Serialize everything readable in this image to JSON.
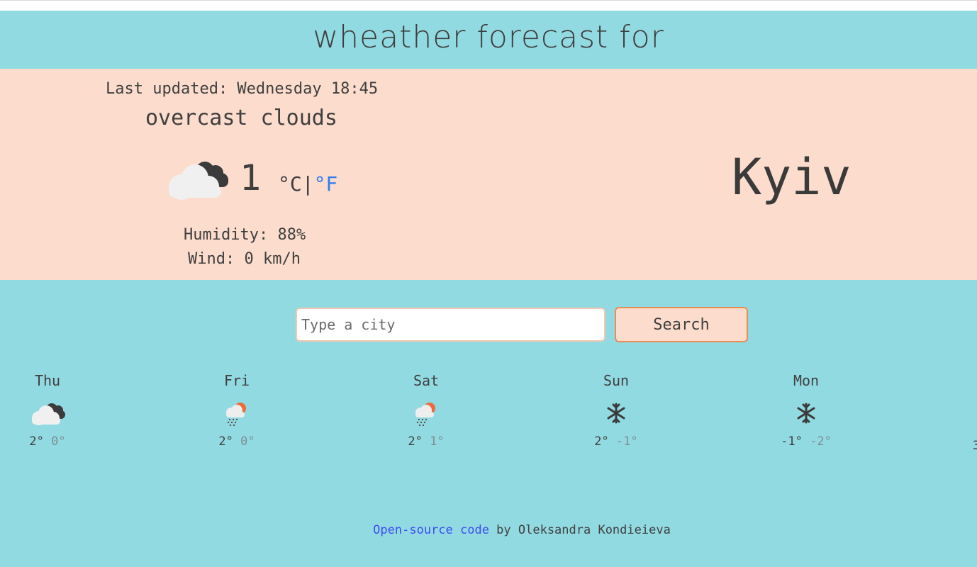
{
  "header": {
    "title": "wheather forecast for"
  },
  "current": {
    "last_updated": "Last updated: Wednesday 18:45",
    "description": "overcast clouds",
    "icon": "overcast-clouds-icon",
    "temperature": "1",
    "unit_c": "°C",
    "unit_sep": "|",
    "unit_f": "°F",
    "humidity": "Humidity: 88%",
    "wind": "Wind: 0 km/h",
    "city": "Kyiv"
  },
  "search": {
    "placeholder": "Type a city",
    "button_label": "Search"
  },
  "forecast": [
    {
      "day": "Thu",
      "icon": "overcast-clouds-icon",
      "max": "2°",
      "min": "0°"
    },
    {
      "day": "Fri",
      "icon": "sun-rain-icon",
      "max": "2°",
      "min": "0°"
    },
    {
      "day": "Sat",
      "icon": "sun-rain-icon",
      "max": "2°",
      "min": "1°"
    },
    {
      "day": "Sun",
      "icon": "snowflake-icon",
      "max": "2°",
      "min": "-1°"
    },
    {
      "day": "Mon",
      "icon": "snowflake-icon",
      "max": "-1°",
      "min": "-2°"
    },
    {
      "day": "",
      "icon": "",
      "max": "3",
      "min": ""
    }
  ],
  "footer": {
    "link_text": "Open-source code",
    "author_text": " by Oleksandra Kondieieva"
  },
  "colors": {
    "header_bg": "#92dae2",
    "current_bg": "#fcdccc",
    "link": "#3c4cf0",
    "fahrenheit": "#2d7cf2",
    "search_border": "#e98d55"
  }
}
